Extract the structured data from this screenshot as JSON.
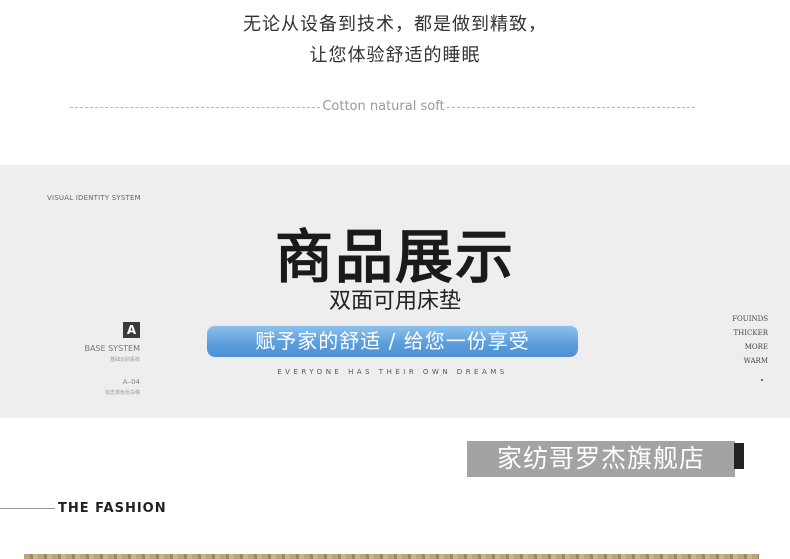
{
  "intro": {
    "line1": "无论从设备到技术，都是做到精致，",
    "line2": "让您体验舒适的睡眠"
  },
  "divider_text": "Cotton natural soft",
  "banner": {
    "corner_label": "VISUAL IDENTITY SYSTEM",
    "title": "商品展示",
    "subtitle": "双面可用床垫",
    "pill_text": "赋予家的舒适 / 给您一份享受",
    "tagline": "EVERYONE HAS THEIR OWN DREAMS",
    "left_block": {
      "badge": "A",
      "system": "BASE SYSTEM",
      "system_cn": "基础识别系统",
      "code": "A–04",
      "code_cn": "标志单色反白稿"
    },
    "right_words": [
      "FOUINDS",
      "THICKER",
      "MORE",
      "WARM"
    ]
  },
  "watermark": "家纺哥罗杰旗舰店",
  "section_heading": "THE FASHION",
  "colors": {
    "banner_bg": "#eeeeee",
    "pill_blue": "#5d9fdc",
    "title_black": "#1a1a1a"
  }
}
